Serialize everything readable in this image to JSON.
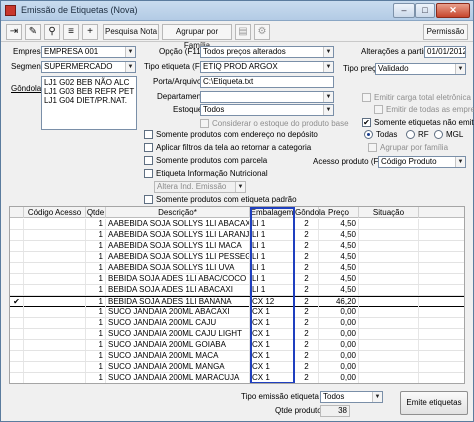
{
  "window": {
    "title": "Emissão de Etiquetas (Nova)",
    "min": "–",
    "max": "□",
    "close": "✕"
  },
  "toolbar": {
    "pesquisa_nota": "Pesquisa Nota",
    "agrupar_familia": "Agrupar por Família",
    "permissao": "Permissão"
  },
  "form": {
    "empresa_label": "Empresa",
    "empresa_value": "EMPRESA 001",
    "segmento_label": "Segmento",
    "segmento_value": "SUPERMERCADO",
    "gondola_label": "Gôndola",
    "gondola_items": [
      "LJ1 G02 BEB NÃO ALC",
      "LJ1 G03 BEB REFR PET",
      "LJ1 G04 DIET/PR.NAT."
    ],
    "opcao_label": "Opção (F11)",
    "opcao_value": "Todos preços alterados",
    "tipo_etiqueta_label": "Tipo etiqueta (F12)",
    "tipo_etiqueta_value": "ETIQ PROD ARGOX",
    "porta_label": "Porta/Arquivo",
    "porta_value": "C:\\Etiqueta.txt",
    "departamento_label": "Departamento",
    "departamento_value": "",
    "estoque_label": "Estoque",
    "estoque_value": "Todos",
    "considerar_estoque": "Considerar o estoque do produto base",
    "alteracoes_label": "Alterações a partir de",
    "alteracoes_value": "01/01/2012",
    "tipo_preco_label": "Tipo preço",
    "tipo_preco_value": "Validado",
    "emitir_carga": "Emitir carga total eletrônica",
    "emitir_todas": "Emitir de todas as empresas",
    "somente_nao_emitidas": "Somente etiquetas não emitidas",
    "radio_todas": "Todas",
    "radio_rf": "RF",
    "radio_mgl": "MGL",
    "agrupar_familia": "Agrupar por família",
    "acesso_label": "Acesso produto (F3)",
    "acesso_value": "Código Produto",
    "chk_endereco": "Somente produtos com endereço no depósito",
    "chk_aplicar": "Aplicar filtros da tela ao retornar a categoria",
    "chk_parcela": "Somente produtos com parcela",
    "chk_nutricional": "Etiqueta Informação Nutricional",
    "altera_ind": "Altera Ind. Emissão",
    "chk_padrao": "Somente produtos com etiqueta padrão"
  },
  "table": {
    "columns": [
      "",
      "Código Acesso",
      "Qtde",
      "Descrição*",
      "Embalagem",
      "Gôndola",
      "Preço",
      "Situação"
    ],
    "rows": [
      {
        "check": "",
        "qtde": "1",
        "desc": "AABEBIDA SOJA SOLLYS 1LI ABACAXI",
        "emb": "LI 1",
        "gond": "2",
        "preco": "4,50"
      },
      {
        "check": "",
        "qtde": "1",
        "desc": "AABEBIDA SOJA SOLLYS 1LI LARANJA +",
        "emb": "LI 1",
        "gond": "2",
        "preco": "4,50"
      },
      {
        "check": "",
        "qtde": "1",
        "desc": "AABEBIDA SOJA SOLLYS 1LI MACA",
        "emb": "LI 1",
        "gond": "2",
        "preco": "4,50"
      },
      {
        "check": "",
        "qtde": "1",
        "desc": "AABEBIDA SOJA SOLLYS 1LI PESSEGO",
        "emb": "LI 1",
        "gond": "2",
        "preco": "4,50"
      },
      {
        "check": "",
        "qtde": "1",
        "desc": "AABEBIDA SOJA SOLLYS 1LI UVA",
        "emb": "LI 1",
        "gond": "2",
        "preco": "4,50"
      },
      {
        "check": "",
        "qtde": "1",
        "desc": "BEBIDA SOJA ADES 1LI ABAC/COCO",
        "emb": "LI 1",
        "gond": "2",
        "preco": "4,50"
      },
      {
        "check": "",
        "qtde": "1",
        "desc": "BEBIDA SOJA ADES 1LI ABACAXI",
        "emb": "LI 1",
        "gond": "2",
        "preco": "4,50"
      },
      {
        "check": "✔",
        "qtde": "1",
        "desc": "BEBIDA SOJA ADES 1LI BANANA",
        "emb": "CX 12",
        "gond": "2",
        "preco": "46,20"
      },
      {
        "check": "",
        "qtde": "1",
        "desc": "SUCO JANDAIA 200ML ABACAXI",
        "emb": "CX 1",
        "gond": "2",
        "preco": "0,00"
      },
      {
        "check": "",
        "qtde": "1",
        "desc": "SUCO JANDAIA 200ML CAJU",
        "emb": "CX 1",
        "gond": "2",
        "preco": "0,00"
      },
      {
        "check": "",
        "qtde": "1",
        "desc": "SUCO JANDAIA 200ML CAJU LIGHT",
        "emb": "CX 1",
        "gond": "2",
        "preco": "0,00"
      },
      {
        "check": "",
        "qtde": "1",
        "desc": "SUCO JANDAIA 200ML GOIABA",
        "emb": "CX 1",
        "gond": "2",
        "preco": "0,00"
      },
      {
        "check": "",
        "qtde": "1",
        "desc": "SUCO JANDAIA 200ML MACA",
        "emb": "CX 1",
        "gond": "2",
        "preco": "0,00"
      },
      {
        "check": "",
        "qtde": "1",
        "desc": "SUCO JANDAIA 200ML MANGA",
        "emb": "CX 1",
        "gond": "2",
        "preco": "0,00"
      },
      {
        "check": "",
        "qtde": "1",
        "desc": "SUCO JANDAIA 200ML MARACUJA",
        "emb": "CX 1",
        "gond": "2",
        "preco": "0,00"
      }
    ]
  },
  "footer": {
    "tipo_emissao_label": "Tipo emissão etiqueta (F6)",
    "tipo_emissao_value": "Todos",
    "qtde_label": "Qtde produtos",
    "qtde_value": "38",
    "emite_button": "Emite etiquetas"
  }
}
